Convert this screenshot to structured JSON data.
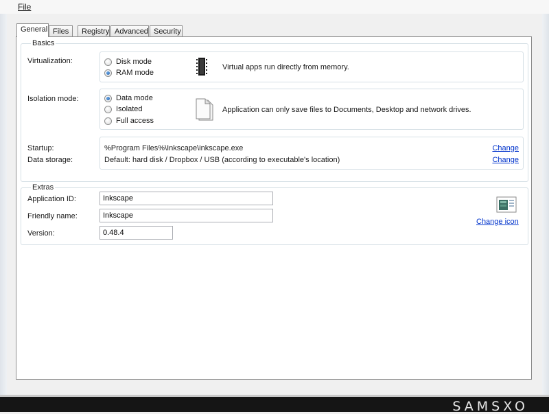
{
  "menu": {
    "file": "File"
  },
  "tabs": [
    "General",
    "Files",
    "Registry",
    "Advanced",
    "Security"
  ],
  "basics": {
    "title": "Basics",
    "virtualization": {
      "label": "Virtualization:",
      "options": [
        "Disk mode",
        "RAM mode"
      ],
      "selected": "RAM mode",
      "description": "Virtual apps run directly from memory.",
      "icon": "memory-chip-icon"
    },
    "isolation": {
      "label": "Isolation mode:",
      "options": [
        "Data mode",
        "Isolated",
        "Full access"
      ],
      "selected": "Data mode",
      "description": "Application can only save files to Documents, Desktop and network drives.",
      "icon": "document-icon"
    },
    "startup": {
      "label": "Startup:",
      "value": "%Program Files%\\Inkscape\\inkscape.exe",
      "change": "Change"
    },
    "data_storage": {
      "label": "Data storage:",
      "value": "Default: hard disk / Dropbox / USB (according to executable's location)",
      "change": "Change"
    }
  },
  "extras": {
    "title": "Extras",
    "app_id": {
      "label": "Application ID:",
      "value": "Inkscape"
    },
    "friendly_name": {
      "label": "Friendly name:",
      "value": "Inkscape"
    },
    "version": {
      "label": "Version:",
      "value": "0.48.4"
    },
    "change_icon": "Change icon",
    "icon": "application-icon"
  },
  "brand": "SAMSXO",
  "colors": {
    "link": "#0033cc",
    "radio_selected": "#1d5aa8",
    "footer": "#151515"
  }
}
